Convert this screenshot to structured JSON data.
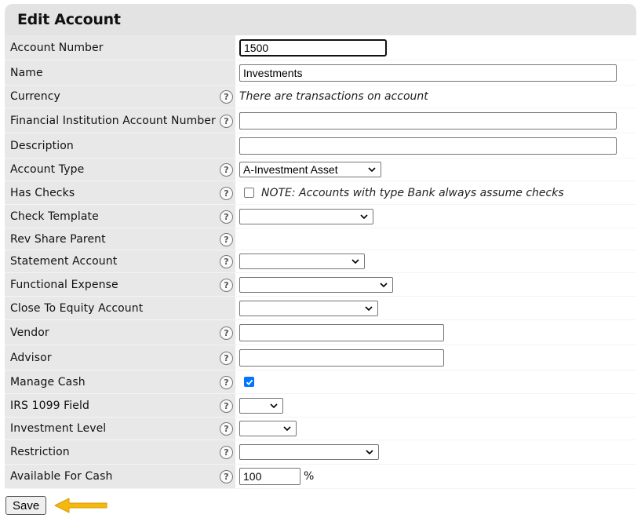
{
  "header": {
    "title": "Edit Account"
  },
  "fields": {
    "account_number": {
      "label": "Account Number",
      "value": "1500"
    },
    "name": {
      "label": "Name",
      "value": "Investments"
    },
    "currency": {
      "label": "Currency",
      "note": "There are transactions on account"
    },
    "fin_inst": {
      "label": "Financial Institution Account Number",
      "value": ""
    },
    "description": {
      "label": "Description",
      "value": ""
    },
    "account_type": {
      "label": "Account Type",
      "selected": "A-Investment Asset"
    },
    "has_checks": {
      "label": "Has Checks",
      "checked": false,
      "note": "NOTE: Accounts with type Bank always assume checks"
    },
    "check_template": {
      "label": "Check Template",
      "selected": ""
    },
    "rev_share_parent": {
      "label": "Rev Share Parent"
    },
    "statement_account": {
      "label": "Statement Account",
      "selected": ""
    },
    "functional_expense": {
      "label": "Functional Expense",
      "selected": ""
    },
    "close_to_equity": {
      "label": "Close To Equity Account",
      "selected": ""
    },
    "vendor": {
      "label": "Vendor",
      "value": ""
    },
    "advisor": {
      "label": "Advisor",
      "value": ""
    },
    "manage_cash": {
      "label": "Manage Cash",
      "checked": true
    },
    "irs_1099": {
      "label": "IRS 1099 Field",
      "selected": ""
    },
    "investment_level": {
      "label": "Investment Level",
      "selected": ""
    },
    "restriction": {
      "label": "Restriction",
      "selected": ""
    },
    "available_for_cash": {
      "label": "Available For Cash",
      "value": "100",
      "unit": "%"
    }
  },
  "help_glyph": "?",
  "save_label": "Save",
  "colors": {
    "label_bg": "#e8e8e8",
    "header_bg": "#e3e3e3",
    "checkbox_accent": "#0075ff",
    "arrow": "#f5b80f"
  }
}
